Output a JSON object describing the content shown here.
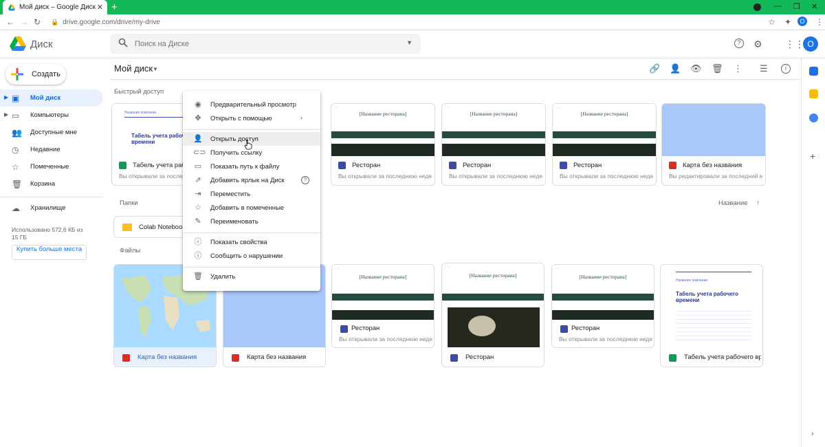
{
  "browser": {
    "tab_title": "Мой диск – Google Диск",
    "url": "drive.google.com/drive/my-drive",
    "profile_initial": "O"
  },
  "header": {
    "app_name": "Диск",
    "search_placeholder": "Поиск на Диске",
    "avatar_initial": "O"
  },
  "sidebar": {
    "create_label": "Создать",
    "items": [
      {
        "label": "Мой диск"
      },
      {
        "label": "Компьютеры"
      },
      {
        "label": "Доступные мне"
      },
      {
        "label": "Недавние"
      },
      {
        "label": "Помеченные"
      },
      {
        "label": "Корзина"
      }
    ],
    "storage_label": "Хранилище",
    "storage_used": "Использовано 572,6 КБ из 15 ГБ",
    "buy_label": "Купить больше места"
  },
  "main": {
    "title": "Мой диск",
    "quick_access_label": "Быстрый доступ",
    "folders_label": "Папки",
    "files_label": "Файлы",
    "sort_label": "Название"
  },
  "quick_access": [
    {
      "name": "Табель учета рабочего времени",
      "sub": "Вы открывали за последний месяц",
      "type": "sheets",
      "thumb_title": "Табель учета рабочего времени",
      "thumb_company": "Название компании"
    },
    {
      "name": "Ресторан",
      "sub": "Вы открывали за последнюю неделю",
      "type": "sites",
      "thumb_title": "[Название ресторана]"
    },
    {
      "name": "Ресторан",
      "sub": "Вы открывали за последнюю неделю",
      "type": "sites",
      "thumb_title": "[Название ресторана]"
    },
    {
      "name": "Ресторан",
      "sub": "Вы открывали за последнюю неделю",
      "type": "sites",
      "thumb_title": "[Название ресторана]"
    },
    {
      "name": "Карта без названия",
      "sub": "Вы редактировали за последний месяц",
      "type": "maps"
    }
  ],
  "folders": [
    {
      "name": "Colab Notebooks"
    }
  ],
  "files": [
    {
      "name": "Карта без названия",
      "type": "maps"
    },
    {
      "name": "Карта без названия",
      "type": "maps"
    },
    {
      "name": "Ресторан",
      "sub": "Вы открывали за последнюю неделю",
      "type": "sites",
      "thumb_title": "[Название ресторана]"
    },
    {
      "name": "Ресторан",
      "type": "sites",
      "thumb_title": "[Название ресторана]"
    },
    {
      "name": "Ресторан",
      "sub": "Вы открывали за последнюю неделю",
      "type": "sites",
      "thumb_title": "[Название ресторана]"
    },
    {
      "name": "Табель учета рабочего времени",
      "type": "sheets",
      "thumb_title": "Табель учета рабочего времени",
      "thumb_company": "Название компании"
    }
  ],
  "context_menu": {
    "items": [
      {
        "label": "Предварительный просмотр",
        "icon": "eye-icon"
      },
      {
        "label": "Открыть с помощью",
        "icon": "move-icon",
        "submenu": true
      },
      {
        "label": "Открыть доступ",
        "icon": "person-add-icon",
        "hover": true
      },
      {
        "label": "Получить ссылку",
        "icon": "link-icon"
      },
      {
        "label": "Показать путь к файлу",
        "icon": "folder-icon"
      },
      {
        "label": "Добавить ярлык на Диск",
        "icon": "shortcut-icon",
        "help": true
      },
      {
        "label": "Переместить",
        "icon": "move-to-icon"
      },
      {
        "label": "Добавить в помеченные",
        "icon": "star-icon"
      },
      {
        "label": "Переименовать",
        "icon": "pencil-icon"
      },
      {
        "label": "Показать свойства",
        "icon": "info-icon"
      },
      {
        "label": "Сообщить о нарушении",
        "icon": "report-icon"
      },
      {
        "label": "Удалить",
        "icon": "trash-icon"
      }
    ]
  },
  "colors": {
    "tabbar": "#11b957",
    "accent": "#1a73e8",
    "active_nav_bg": "#e8f0fe",
    "sheets": "#0f9d58",
    "sites": "#3c4ba6",
    "maps": "#d93025"
  }
}
